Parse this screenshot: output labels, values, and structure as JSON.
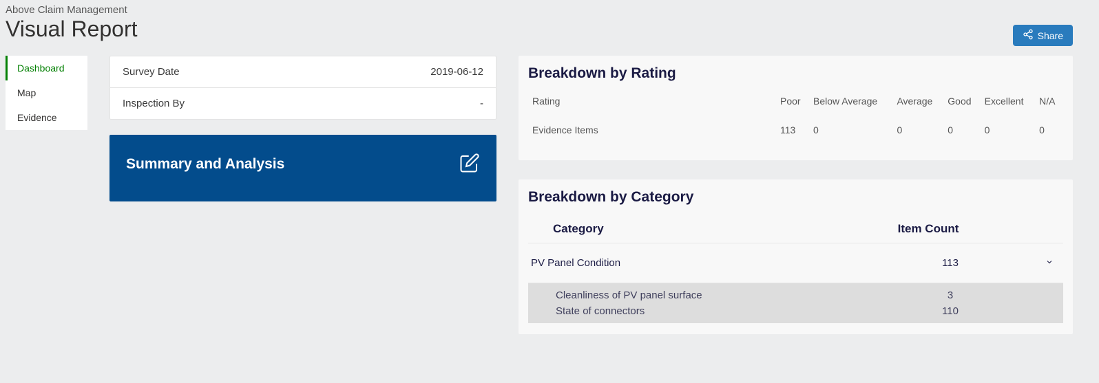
{
  "header": {
    "breadcrumb": "Above Claim Management",
    "title": "Visual Report",
    "share_label": "Share"
  },
  "sidebar": {
    "items": [
      {
        "label": "Dashboard",
        "active": true
      },
      {
        "label": "Map",
        "active": false
      },
      {
        "label": "Evidence",
        "active": false
      }
    ]
  },
  "info_panel": {
    "survey_date_label": "Survey Date",
    "survey_date_value": "2019-06-12",
    "inspection_by_label": "Inspection By",
    "inspection_by_value": "-"
  },
  "summary": {
    "title": "Summary and Analysis"
  },
  "breakdown_rating": {
    "title": "Breakdown by Rating",
    "row_label": "Rating",
    "columns": [
      "Poor",
      "Below Average",
      "Average",
      "Good",
      "Excellent",
      "N/A"
    ],
    "evidence_label": "Evidence Items",
    "evidence_values": [
      "113",
      "0",
      "0",
      "0",
      "0",
      "0"
    ]
  },
  "breakdown_category": {
    "title": "Breakdown by Category",
    "col_category": "Category",
    "col_count": "Item Count",
    "rows": [
      {
        "name": "PV Panel Condition",
        "count": "113",
        "children": [
          {
            "name": "Cleanliness of PV panel surface",
            "count": "3"
          },
          {
            "name": "State of connectors",
            "count": "110"
          }
        ]
      }
    ]
  }
}
